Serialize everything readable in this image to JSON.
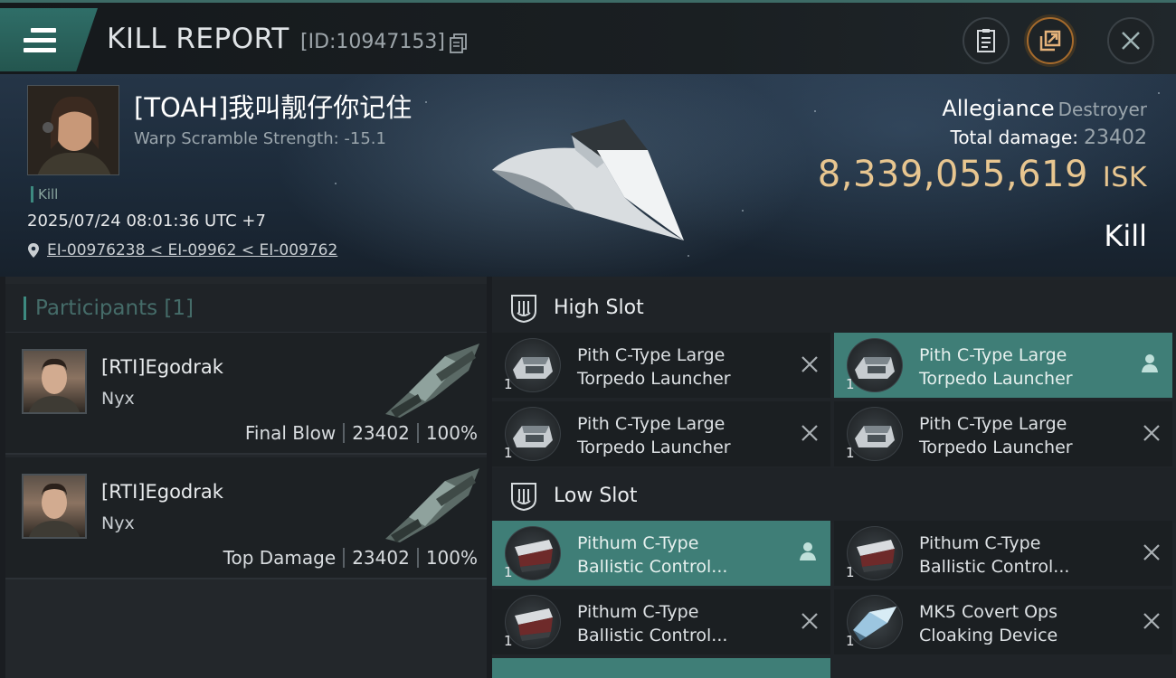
{
  "header": {
    "title": "KILL REPORT",
    "report_id": "[ID:10947153]",
    "icons": [
      "menu-icon",
      "copy-icon",
      "clipboard-icon",
      "share-icon",
      "close-icon"
    ]
  },
  "victim": {
    "name": "[TOAH]我叫靓仔你记住",
    "warp_scramble": "Warp Scramble Strength: -15.1",
    "kill_tag": "Kill",
    "datetime": "2025/07/24 08:01:36 UTC +7",
    "location": "EI-00976238 < EI-09962 < EI-009762",
    "ship_class": "Allegiance",
    "ship_type": "Destroyer",
    "total_damage_label": "Total damage:",
    "total_damage": "23402",
    "isk_value": "8,339,055,619",
    "isk_unit": "ISK",
    "result": "Kill"
  },
  "participants": {
    "header": "Participants [1]",
    "items": [
      {
        "name": "[RTI]Egodrak",
        "ship": "Nyx",
        "role": "Final Blow",
        "damage": "23402",
        "percent": "100%"
      },
      {
        "name": "[RTI]Egodrak",
        "ship": "Nyx",
        "role": "Top Damage",
        "damage": "23402",
        "percent": "100%"
      }
    ]
  },
  "slots": {
    "high": {
      "label": "High Slot",
      "modules": [
        {
          "name": "Pith C-Type Large\nTorpedo Launcher",
          "qty": "1",
          "status": "destroyed"
        },
        {
          "name": "Pith C-Type Large\nTorpedo Launcher",
          "qty": "1",
          "status": "dropped"
        },
        {
          "name": "Pith C-Type Large\nTorpedo Launcher",
          "qty": "1",
          "status": "destroyed"
        },
        {
          "name": "Pith C-Type Large\nTorpedo Launcher",
          "qty": "1",
          "status": "destroyed"
        }
      ]
    },
    "low": {
      "label": "Low Slot",
      "modules": [
        {
          "name": "Pithum C-Type\nBallistic Control...",
          "qty": "1",
          "status": "dropped"
        },
        {
          "name": "Pithum C-Type\nBallistic Control...",
          "qty": "1",
          "status": "destroyed"
        },
        {
          "name": "Pithum C-Type\nBallistic Control...",
          "qty": "1",
          "status": "destroyed"
        },
        {
          "name": "MK5 Covert Ops\nCloaking Device",
          "qty": "1",
          "status": "destroyed"
        }
      ]
    }
  },
  "colors": {
    "accent_teal": "#3f7e77",
    "isk_gold": "#e8c690",
    "share_orange": "#a56a2c"
  }
}
